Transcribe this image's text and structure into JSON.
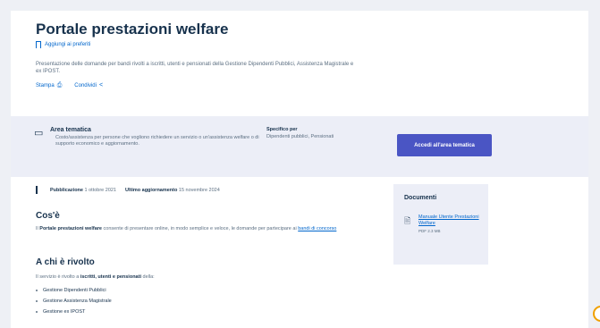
{
  "page": {
    "title": "Portale prestazioni welfare",
    "favourite_label": "Aggiungi ai preferiti",
    "description": "Presentazione delle domande per bandi rivolti a iscritti, utenti e pensionati della Gestione Dipendenti Pubblici, Assistenza Magistrale e ex IPOST.",
    "actions": [
      {
        "label": "Stampa",
        "icon": "printer-icon"
      },
      {
        "label": "Condividi",
        "icon": "share-icon"
      }
    ]
  },
  "topic": {
    "icon": "folder-icon",
    "label": "Area tematica",
    "text": "Costo/assistenza per persone che vogliono richiedere un servizio o un'assistenza welfare o di supporto economico e aggiornamento.",
    "spec_label": "Specifico per",
    "spec_text": "Dipendenti pubblici, Pensionati",
    "button_label": "Accedi all'area tematica"
  },
  "meta": {
    "published_label": "Pubblicazione",
    "published_value": "1 ottobre 2021",
    "updated_label": "Ultimo aggiornamento",
    "updated_value": "15 novembre 2024"
  },
  "content": {
    "what_title": "Cos'è",
    "what_prefix": "Il",
    "what_bold": "Portale prestazioni welfare",
    "what_rest": "consente di presentare online, in modo semplice e veloce, le domande per partecipare ai",
    "what_link": "bandi di concorso",
    "who_title": "A chi è rivolto",
    "who_prefix": "Il servizio è rivolto a",
    "who_bold": "iscritti, utenti e pensionati",
    "who_rest": "della:",
    "who_list": [
      "Gestione Dipendenti Pubblici",
      "Gestione Assistenza Magistrale",
      "Gestione ex IPOST"
    ]
  },
  "documents": {
    "title": "Documenti",
    "icon": "document-icon",
    "link_label": "Manuale Utente Prestazioni Welfare",
    "size": "PDF 2.3 MB"
  },
  "colors": {
    "title": "#17324d",
    "link": "#0066cc",
    "button": "#4a55c4",
    "band": "#eceef7"
  }
}
